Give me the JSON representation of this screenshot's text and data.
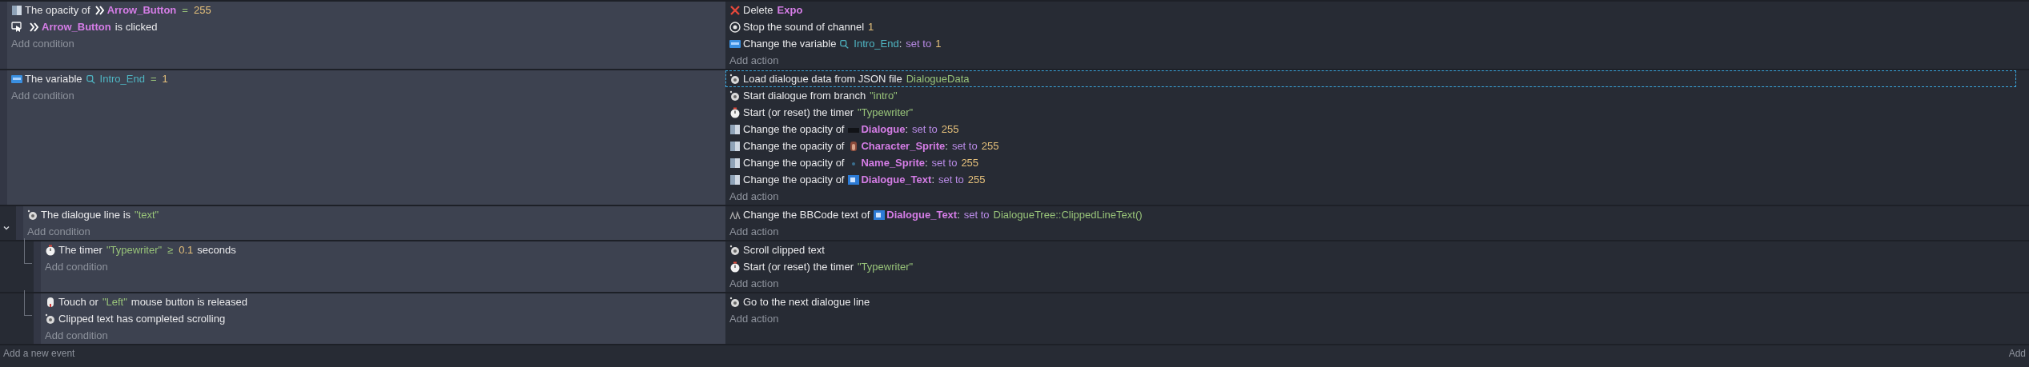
{
  "events": [
    {
      "conditions": [
        {
          "kind": "opacity",
          "selected": false,
          "parts": [
            {
              "kind": "text",
              "t": "The opacity of"
            },
            {
              "kind": "arrows-thumb"
            },
            {
              "kind": "object",
              "t": "Arrow_Button"
            },
            {
              "kind": "op",
              "t": "="
            },
            {
              "kind": "number",
              "t": "255"
            }
          ]
        },
        {
          "kind": "cursor",
          "selected": false,
          "parts": [
            {
              "kind": "arrows-thumb"
            },
            {
              "kind": "object",
              "t": "Arrow_Button"
            },
            {
              "kind": "text",
              "t": "is clicked"
            }
          ]
        }
      ],
      "add_condition": "Add condition",
      "actions": [
        {
          "kind": "delete",
          "selected": false,
          "parts": [
            {
              "kind": "text",
              "t": "Delete"
            },
            {
              "kind": "object",
              "t": "Expo"
            }
          ]
        },
        {
          "kind": "sound",
          "selected": false,
          "parts": [
            {
              "kind": "text",
              "t": "Stop the sound of channel"
            },
            {
              "kind": "number",
              "t": "1"
            }
          ]
        },
        {
          "kind": "variable",
          "selected": false,
          "parts": [
            {
              "kind": "text",
              "t": "Change the variable"
            },
            {
              "kind": "variable",
              "t": "Intro_End"
            },
            {
              "kind": "colon",
              "t": ":"
            },
            {
              "kind": "set",
              "t": "set to"
            },
            {
              "kind": "number",
              "t": "1"
            }
          ]
        }
      ],
      "add_action": "Add action"
    },
    {
      "conditions": [
        {
          "kind": "variable",
          "selected": false,
          "parts": [
            {
              "kind": "text",
              "t": "The variable"
            },
            {
              "kind": "variable",
              "t": "Intro_End"
            },
            {
              "kind": "op",
              "t": "="
            },
            {
              "kind": "number",
              "t": "1"
            }
          ]
        }
      ],
      "add_condition": "Add condition",
      "actions": [
        {
          "kind": "extension",
          "selected": true,
          "parts": [
            {
              "kind": "text",
              "t": "Load dialogue data from JSON file"
            },
            {
              "kind": "string",
              "t": "DialogueData"
            }
          ]
        },
        {
          "kind": "extension",
          "selected": false,
          "parts": [
            {
              "kind": "text",
              "t": "Start dialogue from branch"
            },
            {
              "kind": "string",
              "t": "\"intro\""
            }
          ]
        },
        {
          "kind": "timer",
          "selected": false,
          "parts": [
            {
              "kind": "text",
              "t": "Start (or reset) the timer"
            },
            {
              "kind": "string",
              "t": "\"Typewriter\""
            }
          ]
        },
        {
          "kind": "opacity",
          "selected": false,
          "parts": [
            {
              "kind": "text",
              "t": "Change the opacity of"
            },
            {
              "kind": "dark-thumb"
            },
            {
              "kind": "object",
              "t": "Dialogue"
            },
            {
              "kind": "colon",
              "t": ":"
            },
            {
              "kind": "set",
              "t": "set to"
            },
            {
              "kind": "number",
              "t": "255"
            }
          ]
        },
        {
          "kind": "opacity",
          "selected": false,
          "parts": [
            {
              "kind": "text",
              "t": "Change the opacity of"
            },
            {
              "kind": "portrait-thumb"
            },
            {
              "kind": "object",
              "t": "Character_Sprite"
            },
            {
              "kind": "colon",
              "t": ":"
            },
            {
              "kind": "set",
              "t": "set to"
            },
            {
              "kind": "number",
              "t": "255"
            }
          ]
        },
        {
          "kind": "opacity",
          "selected": false,
          "parts": [
            {
              "kind": "text",
              "t": "Change the opacity of"
            },
            {
              "kind": "dot-thumb"
            },
            {
              "kind": "object",
              "t": "Name_Sprite"
            },
            {
              "kind": "colon",
              "t": ":"
            },
            {
              "kind": "set",
              "t": "set to"
            },
            {
              "kind": "number",
              "t": "255"
            }
          ]
        },
        {
          "kind": "opacity",
          "selected": false,
          "parts": [
            {
              "kind": "text",
              "t": "Change the opacity of"
            },
            {
              "kind": "text-thumb"
            },
            {
              "kind": "object",
              "t": "Dialogue_Text"
            },
            {
              "kind": "colon",
              "t": ":"
            },
            {
              "kind": "set",
              "t": "set to"
            },
            {
              "kind": "number",
              "t": "255"
            }
          ]
        }
      ],
      "add_action": "Add action"
    },
    {
      "expanded": true,
      "conditions": [
        {
          "kind": "extension",
          "selected": false,
          "parts": [
            {
              "kind": "text",
              "t": "The dialogue line is"
            },
            {
              "kind": "string",
              "t": "\"text\""
            }
          ]
        }
      ],
      "add_condition": "Add condition",
      "actions": [
        {
          "kind": "bbcode",
          "selected": false,
          "parts": [
            {
              "kind": "text",
              "t": "Change the BBCode text of"
            },
            {
              "kind": "text-thumb"
            },
            {
              "kind": "object",
              "t": "Dialogue_Text"
            },
            {
              "kind": "colon",
              "t": ":"
            },
            {
              "kind": "set",
              "t": "set to"
            },
            {
              "kind": "string",
              "t": "DialogueTree::ClippedLineText()"
            }
          ]
        }
      ],
      "add_action": "Add action",
      "children": [
        {
          "conditions": [
            {
              "kind": "timer",
              "selected": false,
              "parts": [
                {
                  "kind": "text",
                  "t": "The timer"
                },
                {
                  "kind": "string",
                  "t": "\"Typewriter\""
                },
                {
                  "kind": "op",
                  "t": "≥"
                },
                {
                  "kind": "number",
                  "t": "0.1"
                },
                {
                  "kind": "text",
                  "t": "seconds"
                }
              ]
            }
          ],
          "add_condition": "Add condition",
          "actions": [
            {
              "kind": "extension",
              "selected": false,
              "parts": [
                {
                  "kind": "text",
                  "t": "Scroll clipped text"
                }
              ]
            },
            {
              "kind": "timer",
              "selected": false,
              "parts": [
                {
                  "kind": "text",
                  "t": "Start (or reset) the timer"
                },
                {
                  "kind": "string",
                  "t": "\"Typewriter\""
                }
              ]
            }
          ],
          "add_action": "Add action"
        },
        {
          "conditions": [
            {
              "kind": "mouse",
              "selected": false,
              "parts": [
                {
                  "kind": "text",
                  "t": "Touch or"
                },
                {
                  "kind": "string",
                  "t": "\"Left\""
                },
                {
                  "kind": "text",
                  "t": "mouse button is released"
                }
              ]
            },
            {
              "kind": "extension",
              "selected": false,
              "parts": [
                {
                  "kind": "text",
                  "t": "Clipped text has completed scrolling"
                }
              ]
            }
          ],
          "add_condition": "Add condition",
          "actions": [
            {
              "kind": "extension",
              "selected": false,
              "parts": [
                {
                  "kind": "text",
                  "t": "Go to the next dialogue line"
                }
              ]
            }
          ],
          "add_action": "Add action"
        }
      ]
    }
  ],
  "footer": {
    "add_event": "Add a new event",
    "add_other": "Add"
  }
}
